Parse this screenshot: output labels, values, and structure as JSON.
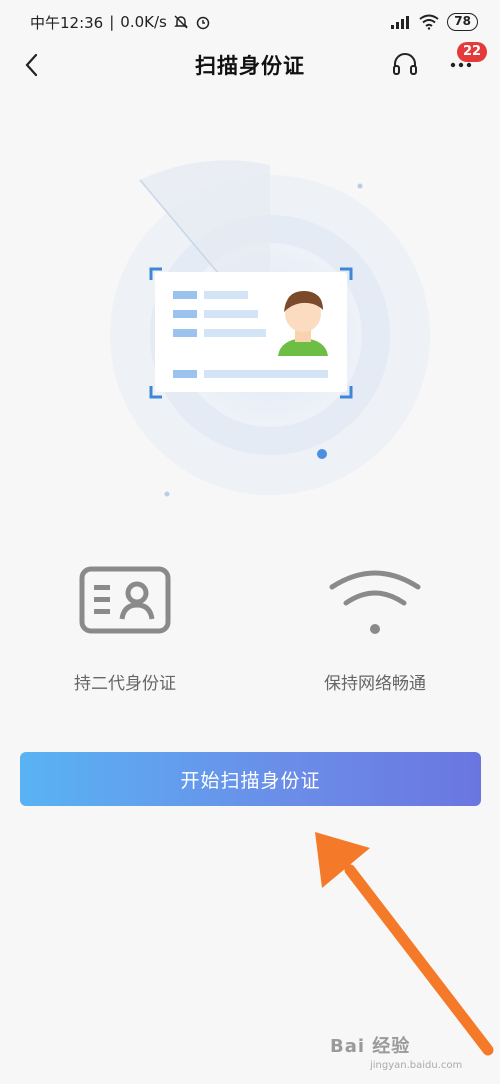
{
  "status_bar": {
    "time": "中午12:36",
    "speed": "0.0K/s",
    "battery": "78"
  },
  "nav": {
    "title": "扫描身份证",
    "more_badge": "22"
  },
  "features": [
    {
      "label": "持二代身份证",
      "icon": "id-card-icon"
    },
    {
      "label": "保持网络畅通",
      "icon": "wifi-icon"
    }
  ],
  "start_button": {
    "label": "开始扫描身份证"
  },
  "watermark": {
    "text": "Bai 经验",
    "url": "jingyan.baidu.com"
  },
  "colors": {
    "accent_start": "#58b3f3",
    "accent_end": "#6a76e0",
    "arrow": "#f47a2a",
    "badge": "#e53a3a"
  }
}
